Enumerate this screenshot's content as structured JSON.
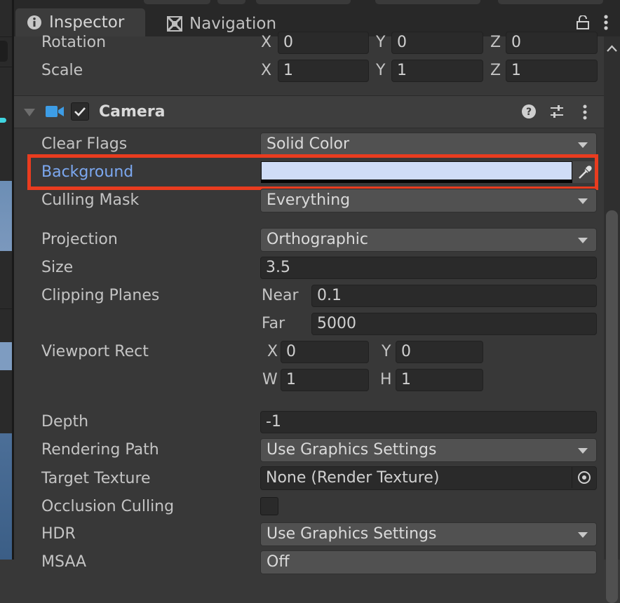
{
  "window": {
    "tabs": [
      {
        "label": "Inspector",
        "icon": "info-icon",
        "active": true
      },
      {
        "label": "Navigation",
        "icon": "navigation-icon",
        "active": false
      }
    ]
  },
  "transform": {
    "rotation": {
      "label": "Rotation",
      "x": "0",
      "y": "0",
      "z": "0"
    },
    "scale": {
      "label": "Scale",
      "x": "1",
      "y": "1",
      "z": "1"
    }
  },
  "camera": {
    "title": "Camera",
    "enabled": true,
    "fields": {
      "clear_flags": {
        "label": "Clear Flags",
        "value": "Solid Color"
      },
      "background": {
        "label": "Background",
        "color": "#cfdcf6"
      },
      "culling_mask": {
        "label": "Culling Mask",
        "value": "Everything"
      },
      "projection": {
        "label": "Projection",
        "value": "Orthographic"
      },
      "size": {
        "label": "Size",
        "value": "3.5"
      },
      "clipping_planes": {
        "label": "Clipping Planes",
        "near_label": "Near",
        "near": "0.1",
        "far_label": "Far",
        "far": "5000"
      },
      "viewport_rect": {
        "label": "Viewport Rect",
        "x": "0",
        "y": "0",
        "w": "1",
        "h": "1"
      },
      "depth": {
        "label": "Depth",
        "value": "-1"
      },
      "rendering_path": {
        "label": "Rendering Path",
        "value": "Use Graphics Settings"
      },
      "target_texture": {
        "label": "Target Texture",
        "value": "None (Render Texture)"
      },
      "occlusion_culling": {
        "label": "Occlusion Culling",
        "checked": false
      },
      "hdr": {
        "label": "HDR",
        "value": "Use Graphics Settings"
      },
      "msaa": {
        "label": "MSAA",
        "value": "Off"
      }
    }
  },
  "axes": {
    "x": "X",
    "y": "Y",
    "z": "Z",
    "w": "W",
    "h": "H"
  },
  "colors": {
    "accent_highlight": "#e93c1f",
    "label_blue": "#7ca8f0",
    "background_swatch": "#cfdcf6"
  }
}
